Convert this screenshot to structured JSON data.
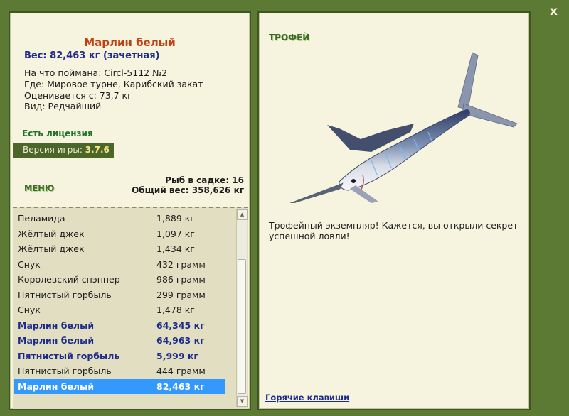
{
  "window": {
    "close_label": "x"
  },
  "catch": {
    "name": "Марлин белый",
    "weight_line": "Вес: 82,463 кг (зачетная)",
    "bait_line": "На что поймана: Circl-5112 №2",
    "location_line": "Где: Мировое турне, Карибский закат",
    "value_line": "Оценивается с: 73,7 кг",
    "rarity_line": "Вид: Редчайший"
  },
  "license_text": "Есть лицензия",
  "version": {
    "label": "Версия игры: ",
    "number": "3.7.6"
  },
  "menu_label": "МЕНЮ",
  "stats": {
    "count_line": "Рыб в садке: 16",
    "total_line": "Общий вес: 358,626 кг"
  },
  "fish_list": [
    {
      "name": "Пеламида",
      "weight": "1,889 кг",
      "bold": false,
      "selected": false
    },
    {
      "name": "Жёлтый джек",
      "weight": "1,097 кг",
      "bold": false,
      "selected": false
    },
    {
      "name": "Жёлтый джек",
      "weight": "1,434 кг",
      "bold": false,
      "selected": false
    },
    {
      "name": "Снук",
      "weight": "432 грамм",
      "bold": false,
      "selected": false
    },
    {
      "name": "Королевский снэппер",
      "weight": "986 грамм",
      "bold": false,
      "selected": false
    },
    {
      "name": "Пятнистый горбыль",
      "weight": "299 грамм",
      "bold": false,
      "selected": false
    },
    {
      "name": "Снук",
      "weight": "1,478 кг",
      "bold": false,
      "selected": false
    },
    {
      "name": "Марлин белый",
      "weight": "64,345 кг",
      "bold": true,
      "selected": false
    },
    {
      "name": "Марлин белый",
      "weight": "64,963 кг",
      "bold": true,
      "selected": false
    },
    {
      "name": "Пятнистый горбыль",
      "weight": "5,999 кг",
      "bold": true,
      "selected": false
    },
    {
      "name": "Пятнистый горбыль",
      "weight": "444 грамм",
      "bold": false,
      "selected": false
    },
    {
      "name": "Марлин белый",
      "weight": "82,463 кг",
      "bold": true,
      "selected": true
    }
  ],
  "trophy": {
    "title": "ТРОФЕЙ",
    "description": "Трофейный экземпляр! Кажется, вы открыли секрет успешной ловли!"
  },
  "hotkeys_label": "Горячие клавиши",
  "colors": {
    "frame": "#5d7a34",
    "panel": "#f6f4de",
    "list_bg": "#e1dec2",
    "selection": "#3399ff",
    "fish_name": "#c0410f",
    "highlight_text": "#1f2b8a",
    "license": "#227328"
  }
}
